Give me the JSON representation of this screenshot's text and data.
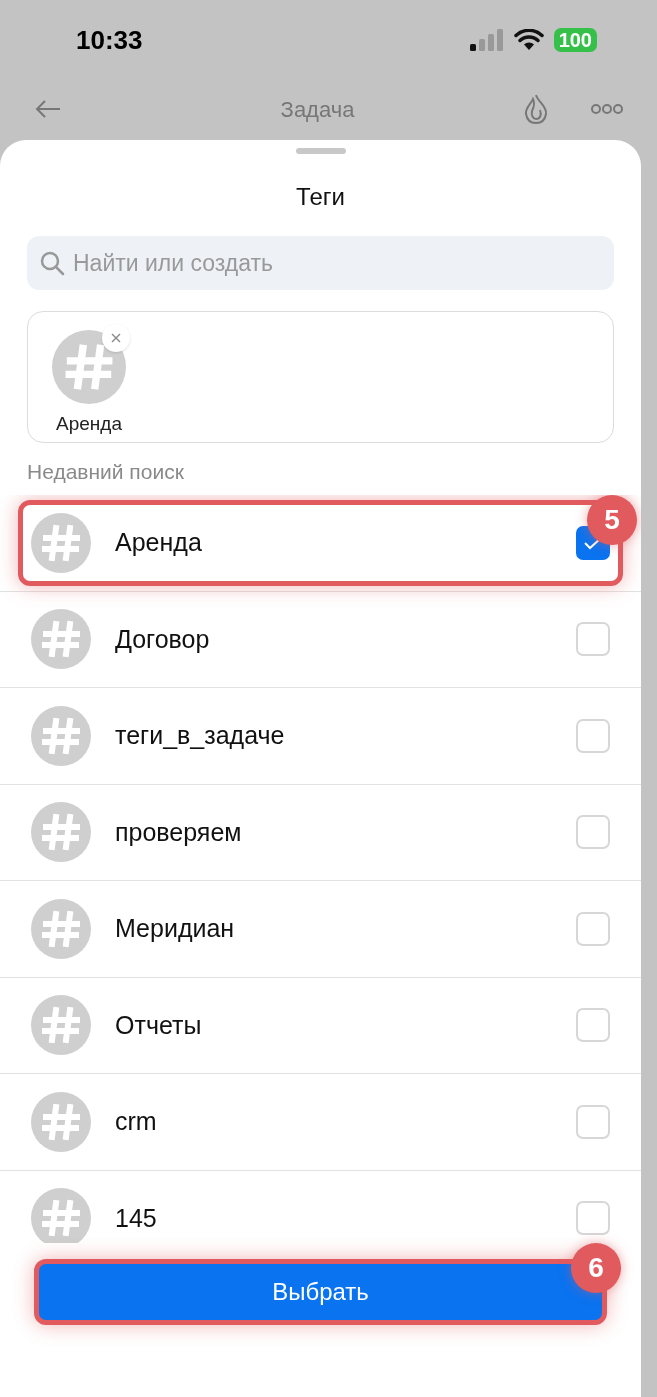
{
  "status_bar": {
    "time": "10:33",
    "battery": "100"
  },
  "header": {
    "title": "Задача"
  },
  "sheet": {
    "title": "Теги",
    "search": {
      "placeholder": "Найти или создать"
    },
    "selected_tags": [
      {
        "label": "Аренда"
      }
    ],
    "section_label": "Недавний поиск",
    "tags": [
      {
        "label": "Аренда",
        "checked": true,
        "callout": "5"
      },
      {
        "label": "Договор",
        "checked": false
      },
      {
        "label": "теги_в_задаче",
        "checked": false
      },
      {
        "label": "проверяем",
        "checked": false
      },
      {
        "label": "Меридиан",
        "checked": false
      },
      {
        "label": "Отчеты",
        "checked": false
      },
      {
        "label": "crm",
        "checked": false
      },
      {
        "label": "145",
        "checked": false
      }
    ],
    "button": {
      "label": "Выбрать",
      "callout": "6"
    }
  }
}
